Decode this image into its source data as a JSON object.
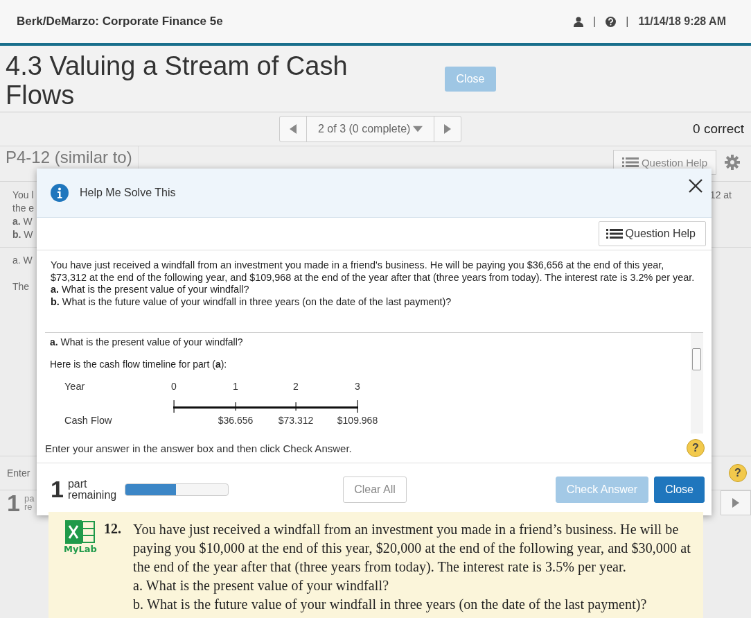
{
  "header": {
    "title": "Berk/DeMarzo: Corporate Finance 5e",
    "separators": [
      "|",
      "|"
    ],
    "datetime": "11/14/18 9:28 AM"
  },
  "page": {
    "title": "4.3 Valuing a Stream of Cash Flows",
    "close_button": "Close"
  },
  "pager": {
    "label": "2 of 3 (0 complete)",
    "score": "0 correct"
  },
  "question": {
    "id": "P4-12 (similar to)",
    "help_button": "Question Help",
    "fragments_top": [
      "You l",
      "the e",
      "**a.** W",
      "**b.** W"
    ],
    "fragment_right": "12 at",
    "fragments_mid": [
      "a. W",
      "The"
    ],
    "enter_fragment": "Enter",
    "part_count": "1",
    "part_fragments": [
      "pa",
      "re"
    ],
    "help_mark": "?"
  },
  "dialog": {
    "title": "Help Me Solve This",
    "help_button": "Question Help",
    "problem": [
      "You have just received a windfall from an investment you made in a friend's business. He will be paying you $36,656 at the end of this year, $73,312 at the end of the following year, and $109,968 at the end of the year after that (three years from today). The interest rate is 3.2% per year.",
      "**a.** What is the present value of your windfall?",
      "**b.** What is the future value of your windfall in three years (on the date of the last payment)?"
    ],
    "step": {
      "question": "**a.** What is the present value of your windfall?",
      "intro": "Here is the cash flow timeline for part (**a**):",
      "row_labels": [
        "Year",
        "Cash Flow"
      ],
      "years": [
        "0",
        "1",
        "2",
        "3"
      ],
      "cash_flows": [
        "$36.656",
        "$73.312",
        "$109.968"
      ]
    },
    "instruction": "Enter your answer in the answer box and then click Check Answer.",
    "help_mark": "?",
    "parts": {
      "count": "1",
      "label": [
        "part",
        "remaining"
      ],
      "level": 0.49
    },
    "buttons": [
      {
        "label": "Clear All",
        "kind": "secondary",
        "disabled": false
      },
      {
        "label": "Check Answer",
        "kind": "primary",
        "disabled": true
      },
      {
        "label": "Close",
        "kind": "primary",
        "disabled": false
      }
    ]
  },
  "textbook": {
    "logo": "MyLab",
    "number": "12.",
    "text": "You have just received a windfall from an investment you made in a friend’s business. He will be paying you $10,000 at the end of this year, $20,000 at the end of the following year, and $30,000 at the end of the year after that (three years from today). The interest rate is 3.5% per year.",
    "items": [
      "a. What is the present value of your windfall?",
      "b. What is the future value of your windfall in three years (on the date of the last payment)?"
    ]
  }
}
